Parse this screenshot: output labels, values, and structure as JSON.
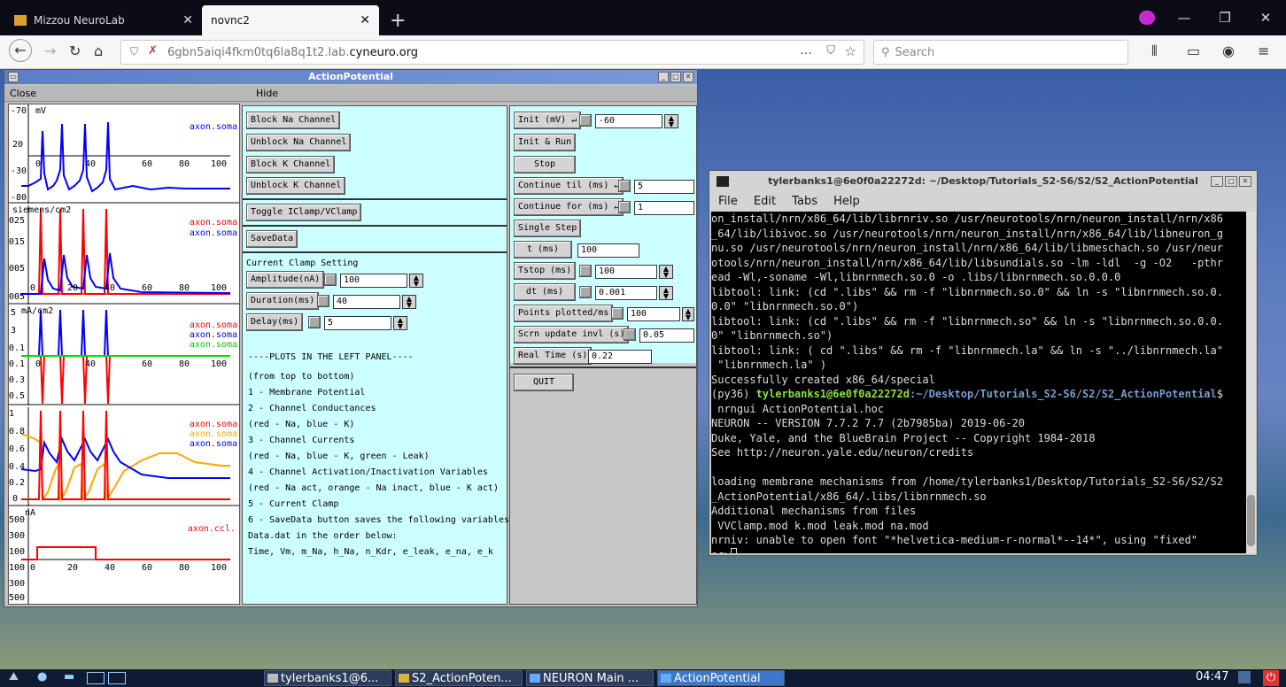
{
  "browser": {
    "tabs": [
      {
        "title": "Mizzou NeuroLab"
      },
      {
        "title": "novnc2"
      }
    ],
    "url_subdomain": "6gbn5aiqi4fkm0tq6la8q1t2.lab.",
    "url_domain": "cyneuro.org",
    "search_placeholder": "Search",
    "page_actions": "…"
  },
  "ap_window": {
    "title": "ActionPotential",
    "menu": {
      "close": "Close",
      "hide": "Hide"
    },
    "plots": [
      {
        "ylabel": "mV",
        "yticks": [
          "-70",
          "20",
          "-30",
          "-80"
        ],
        "xticks": [
          "0",
          "40",
          "60",
          "80",
          "100"
        ],
        "legend": [
          "axon.soma"
        ],
        "legend_colors": [
          "#0000ff"
        ]
      },
      {
        "ylabel": "siemens/cm2",
        "yticks": [
          "025",
          "015",
          "005",
          "005"
        ],
        "xticks": [
          "0",
          "20",
          "40",
          "60",
          "80",
          "100"
        ],
        "legend": [
          "axon.soma",
          "axon.soma"
        ],
        "legend_colors": [
          "#ff0000",
          "#0000ff"
        ]
      },
      {
        "ylabel": "mA/cm2",
        "yticks": [
          "5",
          "3",
          "0.1",
          "0.1",
          "0.3",
          "0.5"
        ],
        "xticks": [
          "0",
          "40",
          "60",
          "80",
          "100"
        ],
        "legend": [
          "axon.soma",
          "axon.soma",
          "axon.soma"
        ],
        "legend_colors": [
          "#ff0000",
          "#0000ff",
          "#00cc00"
        ]
      },
      {
        "ylabel": "",
        "yticks": [
          "1",
          "0.8",
          "0.6",
          "0.4",
          "0.2",
          "0"
        ],
        "xticks": [],
        "legend": [
          "axon.soma",
          "axon.soma",
          "axon.soma"
        ],
        "legend_colors": [
          "#ff0000",
          "#ffa500",
          "#0000ff"
        ]
      },
      {
        "ylabel": "nA",
        "yticks": [
          "500",
          "300",
          "100",
          "100",
          "300",
          "500"
        ],
        "xticks": [
          "0",
          "20",
          "40",
          "60",
          "80",
          "100"
        ],
        "legend": [
          "axon.ccl."
        ],
        "legend_colors": [
          "#ff0000"
        ]
      }
    ],
    "mid": {
      "block_na": "Block Na Channel",
      "unblock_na": "Unblock Na Channel",
      "block_k": "Block K Channel",
      "unblock_k": "Unblock K Channel",
      "toggle": "Toggle IClamp/VClamp",
      "savedata": "SaveData",
      "clamp_heading": "Current Clamp Setting",
      "amplitude_label": "Amplitude(nA)",
      "amplitude_value": "100",
      "duration_label": "Duration(ms)",
      "duration_value": "40",
      "delay_label": "Delay(ms)",
      "delay_value": "5",
      "notes": [
        "----PLOTS IN THE LEFT PANEL----",
        "(from top to bottom)",
        "1 - Membrane Potential",
        "2 - Channel Conductances",
        "    (red - Na, blue - K)",
        "3 - Channel Currents",
        "    (red - Na, blue - K, green - Leak)",
        "4 - Channel Activation/Inactivation Variables",
        "    (red - Na act, orange - Na inact, blue - K act)",
        "5 - Current Clamp",
        "6 - SaveData button saves the following variables in",
        "    Data.dat in the order below:",
        "    Time, Vm, m_Na, h_Na, n_Kdr, e_leak, e_na, e_k"
      ]
    },
    "run": {
      "init_label": "Init (mV) ↵",
      "init_value": "-60",
      "init_run": "Init & Run",
      "stop": "Stop",
      "continue_til_label": "Continue til (ms) ↵",
      "continue_til_value": "5",
      "continue_for_label": "Continue for (ms) ↵",
      "continue_for_value": "1",
      "single_step": "Single Step",
      "t_label": "t (ms)",
      "t_value": "100",
      "tstop_label": "Tstop (ms)",
      "tstop_value": "100",
      "dt_label": "dt (ms)",
      "dt_value": "0.001",
      "points_label": "Points plotted/ms",
      "points_value": "100",
      "scrn_label": "Scrn update invl (s)",
      "scrn_value": "0.05",
      "realtime_label": "Real Time (s)",
      "realtime_value": "0.22",
      "quit": "QUIT"
    }
  },
  "terminal": {
    "title": "tylerbanks1@6e0f0a22272d: ~/Desktop/Tutorials_S2-S6/S2/S2_ActionPotential",
    "menu": [
      "File",
      "Edit",
      "Tabs",
      "Help"
    ],
    "lines_before": "on_install/nrn/x86_64/lib/librnriv.so /usr/neurotools/nrn/neuron_install/nrn/x86\n_64/lib/libivoc.so /usr/neurotools/nrn/neuron_install/nrn/x86_64/lib/libneuron_g\nnu.so /usr/neurotools/nrn/neuron_install/nrn/x86_64/lib/libmeschach.so /usr/neur\notools/nrn/neuron_install/nrn/x86_64/lib/libsundials.so -lm -ldl  -g -O2   -pthr\nead -Wl,-soname -Wl,libnrnmech.so.0 -o .libs/libnrnmech.so.0.0.0\nlibtool: link: (cd \".libs\" && rm -f \"libnrnmech.so.0\" && ln -s \"libnrnmech.so.0.\n0.0\" \"libnrnmech.so.0\")\nlibtool: link: (cd \".libs\" && rm -f \"libnrnmech.so\" && ln -s \"libnrnmech.so.0.0.\n0\" \"libnrnmech.so\")\nlibtool: link: ( cd \".libs\" && rm -f \"libnrnmech.la\" && ln -s \"../libnrnmech.la\"\n \"libnrnmech.la\" )\nSuccessfully created x86_64/special",
    "prompt_env": "(py36) ",
    "prompt_user": "tylerbanks1@6e0f0a22272d",
    "prompt_path": ":~/Desktop/Tutorials_S2-S6/S2/S2_ActionPotential",
    "prompt_sign": "$",
    "lines_after": " nrngui ActionPotential.hoc\nNEURON -- VERSION 7.7.2 7.7 (2b7985ba) 2019-06-20\nDuke, Yale, and the BlueBrain Project -- Copyright 1984-2018\nSee http://neuron.yale.edu/neuron/credits\n\nloading membrane mechanisms from /home/tylerbanks1/Desktop/Tutorials_S2-S6/S2/S2\n_ActionPotential/x86_64/.libs/libnrnmech.so\nAdditional mechanisms from files\n VVClamp.mod k.mod leak.mod na.mod\nnrniv: unable to open font \"*helvetica-medium-r-normal*--14*\", using \"fixed\"\noc>"
  },
  "taskbar": {
    "tasks": [
      "tylerbanks1@6...",
      "S2_ActionPoten...",
      "NEURON Main ...",
      "ActionPotential"
    ],
    "clock": "04:47"
  },
  "colors": {
    "title_gradient_start": "#5a7ec8",
    "panel_bg": "#ccffff",
    "terminal_bg": "#000000",
    "prompt_green": "#8ae234",
    "prompt_blue": "#729fcf"
  }
}
